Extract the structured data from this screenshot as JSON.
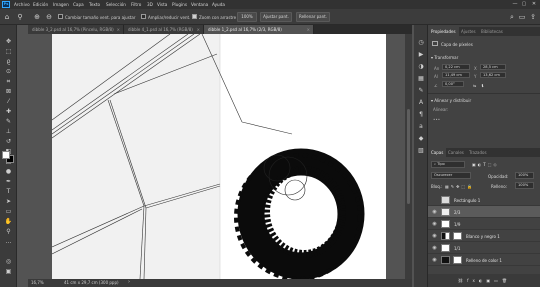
{
  "menubar": {
    "logo": "Ps",
    "items": [
      "Archivo",
      "Edición",
      "Imagen",
      "Capa",
      "Texto",
      "Selección",
      "Filtro",
      "3D",
      "Vista",
      "Plugins",
      "Ventana",
      "Ayuda"
    ],
    "window_controls": [
      "—",
      "▢",
      "✕"
    ]
  },
  "options_bar": {
    "resize_windows_label": "Cambiar tamaño vent. para ajustar",
    "zoom_all_label": "Ampliar/reducir vent.",
    "scrubby_zoom_label": "Zoom con arrastre",
    "zoom_value": "100%",
    "fit_screen_label": "Ajustar pant.",
    "fill_screen_label": "Rellenar pant."
  },
  "tabs": [
    {
      "label": "dibble 3_2.psd al 16,7% (Pincelu, RGB/8)",
      "active": false
    },
    {
      "label": "dibble 4_1.psd al 16,7% (RGB/8)",
      "active": false
    },
    {
      "label": "dibble 1_2.psd al 16,7% (2/3, RGB/8)",
      "active": true
    }
  ],
  "status": {
    "zoom": "16,7%",
    "doc_size": "41 cm x 29,7 cm (300 ppp)"
  },
  "properties_panel": {
    "tabs": [
      "Propiedades",
      "Ajustes",
      "Bibliotecas"
    ],
    "layer_type": "Capa de píxeles",
    "transform_header": "Transformar",
    "w": "0,22 cm",
    "x": "28,5 cm",
    "h": "11,49 cm",
    "y": "13,62 cm",
    "angle": "0,00°",
    "align_header": "Alinear y distribuir",
    "align_label": "Alinear:"
  },
  "layers_panel": {
    "tabs": [
      "Capas",
      "Canales",
      "Trazados"
    ],
    "kind_filter": "Tipo",
    "blend_mode": "Oscurecer",
    "opacity_label": "Opacidad:",
    "opacity_value": "100%",
    "lock_label": "Bloq.:",
    "fill_label": "Relleno:",
    "fill_value": "100%",
    "layers": [
      {
        "name": "Rectángulo 1",
        "visible": false,
        "selected": false,
        "thumb": "#dcdcdc"
      },
      {
        "name": "2/3",
        "visible": true,
        "selected": true,
        "thumb": "#efefef"
      },
      {
        "name": "1/9",
        "visible": true,
        "selected": false,
        "thumb": "#ffffff"
      },
      {
        "name": "Blanco y negro 1",
        "visible": true,
        "selected": false,
        "thumb": "#ffffff"
      },
      {
        "name": "1/1",
        "visible": true,
        "selected": false,
        "thumb": "#ffffff"
      },
      {
        "name": "Relleno de color 1",
        "visible": true,
        "selected": false,
        "thumb": "#111111"
      }
    ]
  },
  "colors": {
    "foreground": "#ffffff",
    "background": "#000000",
    "accent": "#31a8ff"
  }
}
